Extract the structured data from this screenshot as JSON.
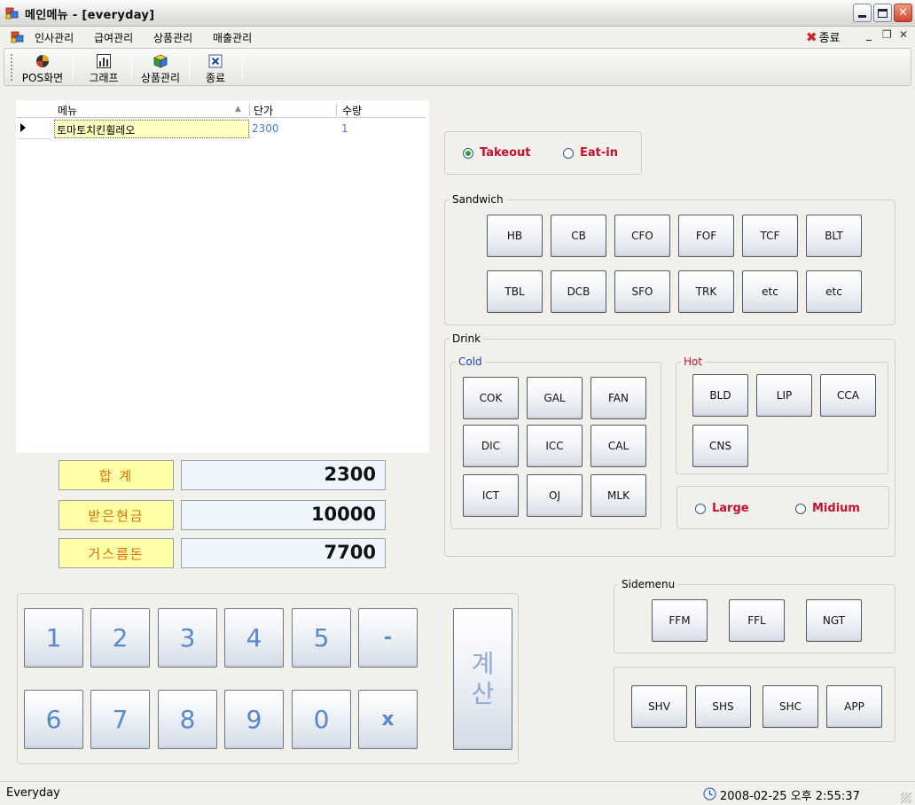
{
  "window": {
    "title": "메인메뉴 - [everyday]"
  },
  "menubar": {
    "items": [
      "인사관리",
      "급여관리",
      "상품관리",
      "매출관리"
    ],
    "close_label": "종료"
  },
  "toolbar": {
    "buttons": [
      {
        "label": "POS화면",
        "icon": "pos-icon"
      },
      {
        "label": "그래프",
        "icon": "chart-icon"
      },
      {
        "label": "상품관리",
        "icon": "products-icon"
      },
      {
        "label": "종료",
        "icon": "close-icon"
      }
    ]
  },
  "grid": {
    "columns": [
      "메뉴",
      "단가",
      "수량"
    ],
    "rows": [
      {
        "menu": "토마토치킨휠레오",
        "price": "2300",
        "qty": "1"
      }
    ]
  },
  "totals": {
    "sum_label": "합  계",
    "sum_value": "2300",
    "received_label": "받은현금",
    "received_value": "10000",
    "change_label": "거스름돈",
    "change_value": "7700"
  },
  "order_type": {
    "options": [
      "Takeout",
      "Eat-in"
    ],
    "selected": "Takeout"
  },
  "sandwich": {
    "title": "Sandwich",
    "row1": [
      "HB",
      "CB",
      "CFO",
      "FOF",
      "TCF",
      "BLT"
    ],
    "row2": [
      "TBL",
      "DCB",
      "SFO",
      "TRK",
      "etc",
      "etc"
    ]
  },
  "drink": {
    "title": "Drink",
    "cold_title": "Cold",
    "cold": [
      "COK",
      "GAL",
      "FAN",
      "DIC",
      "ICC",
      "CAL",
      "ICT",
      "OJ",
      "MLK"
    ],
    "hot_title": "Hot",
    "hot": [
      "BLD",
      "LIP",
      "CCA",
      "CNS"
    ],
    "sizes": [
      "Large",
      "Midium"
    ],
    "colors": {
      "cold": "#1f3fbf",
      "hot": "#c8102e"
    }
  },
  "sidemenu": {
    "title": "Sidemenu",
    "items": [
      "FFM",
      "FFL",
      "NGT"
    ]
  },
  "extras": [
    "SHV",
    "SHS",
    "SHC",
    "APP"
  ],
  "keypad": {
    "row1": [
      "1",
      "2",
      "3",
      "4",
      "5",
      "-"
    ],
    "row2": [
      "6",
      "7",
      "8",
      "9",
      "0",
      "x"
    ],
    "calc_label_1": "계",
    "calc_label_2": "산"
  },
  "status": {
    "left": "Everyday",
    "datetime": "2008-02-25 오후 2:55:37"
  }
}
